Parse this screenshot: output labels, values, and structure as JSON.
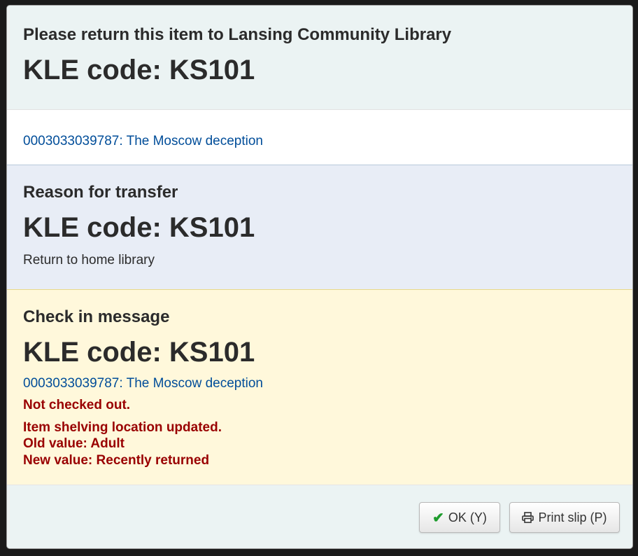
{
  "header": {
    "title": "Please return this item to Lansing Community Library",
    "code": "KLE code: KS101"
  },
  "item": {
    "link_text": "0003033039787: The Moscow deception"
  },
  "reason": {
    "title": "Reason for transfer",
    "code": "KLE code: KS101",
    "text": "Return to home library"
  },
  "checkin": {
    "title": "Check in message",
    "code": "KLE code: KS101",
    "link_text": "0003033039787: The Moscow deception",
    "not_checked_out": "Not checked out.",
    "location_updated": "Item shelving location updated.",
    "old_value": "Old value: Adult",
    "new_value": "New value: Recently returned"
  },
  "footer": {
    "ok_label": "OK (Y)",
    "print_label": "Print slip (P)",
    "ok_icon": "check-icon",
    "print_icon": "print-icon",
    "ok_icon_color": "#1e9c2d"
  }
}
